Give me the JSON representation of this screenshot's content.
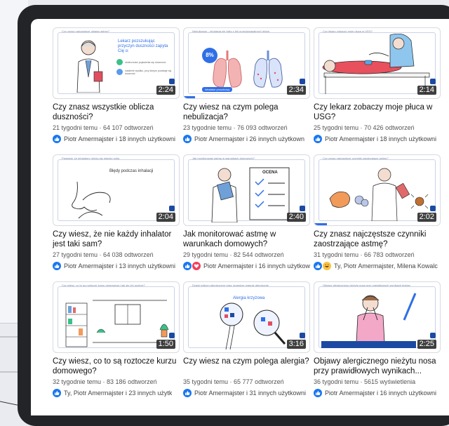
{
  "colors": {
    "accent": "#2f6fe6",
    "brand": "#1b4aa3",
    "frame": "#222428"
  },
  "videos": [
    {
      "thumb_caption": "Czy znasz najczęstsze objawy astmy?",
      "title": "Czy znasz wszystkie oblicza duszności?",
      "meta": "21 tygodni temu · 64 107 odtworzeń",
      "reactions": "Piotr Amermajster i 18 innych użytkowni",
      "duration": "2:24",
      "thumb_text_1": "Lekarz pozszukując przyczyn duszności zapyta Cię o:",
      "thumb_text_2": "okoliczności pojawienia się duszności",
      "thumb_text_3": "nasilenie wysiłku, przy którym powstaje się duszność",
      "progress": 0
    },
    {
      "thumb_caption": "Nebulizacja – inhalacja nie tylko z lek przeciwzapalnych leków",
      "title": "Czy wiesz na czym polega nebulizacja?",
      "meta": "23 tygodnie temu · 76 093 odtworzeń",
      "reactions": "Piotr Amermajster i 26 innych użytkown",
      "duration": "2:34",
      "thumb_text_1": "8%",
      "thumb_text_2": "inhalator proszkowy",
      "thumb_text_3": "",
      "progress": 0.09
    },
    {
      "thumb_caption": "Czy lekarz zobaczy moje płuca w USG?",
      "title": "Czy lekarz zobaczy moje płuca w USG?",
      "meta": "25 tygodni temu · 70 426 odtworzeń",
      "reactions": "Piotr Amermajster i 18 innych użytkowni",
      "duration": "2:14",
      "progress": 0
    },
    {
      "thumb_caption": "Pamiętaj, że inhalatory różnią się między sobą",
      "title": "Czy wiesz, że nie każdy inhalator jest taki sam?",
      "meta": "27 tygodni temu · 64 038 odtworzeń",
      "reactions": "Piotr Amermajster i 13 innych użytkowni",
      "duration": "2:04",
      "thumb_text_1": "Błędy podczas inhalacji",
      "progress": 0
    },
    {
      "thumb_caption": "Jak monitorować astmę w warunkach domowych?",
      "title": "Jak monitorować astmę w warunkach domowych?",
      "meta": "29 tygodni temu · 82 544 odtworzeń",
      "reactions": "Piotr Amermajster i 16 innych użytkow",
      "duration": "2:40",
      "thumb_text_1": "OCENA",
      "progress": 0
    },
    {
      "thumb_caption": "Czy znasz najczęstsze czynniki zaostrzające astmę?",
      "title": "Czy znasz najczęstsze czynniki zaostrzające astmę?",
      "meta": "31 tygodni temu · 66 783 odtworzeń",
      "reactions": "Ty, Piotr Amermajster, Milena Kowalc",
      "duration": "2:02",
      "progress": 0.1
    },
    {
      "thumb_caption": "Czy wiesz, co to są roztocze kurzu domowego i jak się ich pozbyć?",
      "title": "Czy wiesz, co to są roztocze kurzu domowego?",
      "meta": "32 tygodnie temu · 83 186 odtworzeń",
      "reactions": "Ty, Piotr Amermajster i 23 innych użytk",
      "duration": "1:50",
      "progress": 0
    },
    {
      "thumb_caption": "Dzięki pyłkom alergicznym nasz organizm reaguje alergicznie",
      "title": "Czy wiesz na czym polega alergia?",
      "meta": "35 tygodni temu · 65 777 odtworzeń",
      "reactions": "Piotr Amermajster i 31 innych użytkowni",
      "duration": "3:16",
      "thumb_text_1": "Alergia krzyżowa",
      "progress": 0
    },
    {
      "thumb_caption": "Objawy alergicznego nieżytu nosa przy prawidłowych wynikach testów",
      "title": "Objawy alergicznego nieżytu nosa przy prawidłowych wynikach...",
      "meta": "36 tygodni temu · 5615 wyświetlenia",
      "reactions": "Piotr Amermajster i 16 innych użytkowni",
      "duration": "2:25",
      "progress": 0
    }
  ]
}
